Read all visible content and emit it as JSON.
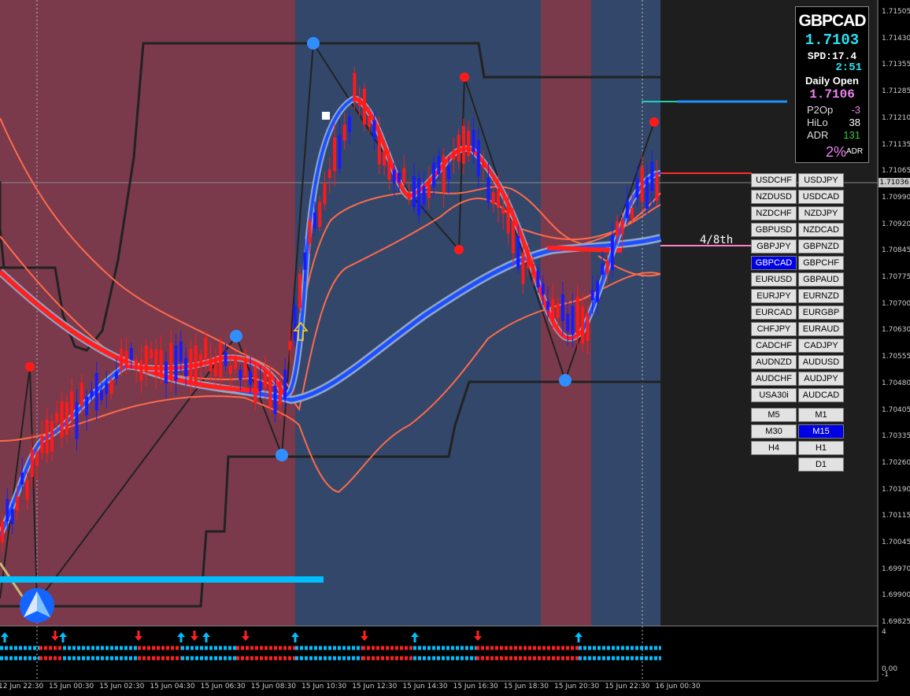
{
  "symbol": "GBPCAD",
  "bid": "1.7103",
  "spread": "SPD:17.4",
  "candle_timer": "2:51",
  "daily_open_label": "Daily Open",
  "daily_open_value": "1.7106",
  "stats": [
    {
      "label": "P2Op",
      "value": "-3",
      "color": "#ee82ee"
    },
    {
      "label": "HiLo",
      "value": "38",
      "color": "#ffffff"
    },
    {
      "label": "ADR",
      "value": "131",
      "color": "#32cd32"
    }
  ],
  "adr_percent": "2%",
  "adr_suffix": "ADR",
  "current_price_tag": "1.71036",
  "level_label": "4/8th",
  "price_axis": [
    "1.71505",
    "1.71430",
    "1.71355",
    "1.71285",
    "1.71210",
    "1.71135",
    "1.71065",
    "1.70990",
    "1.70920",
    "1.70845",
    "1.70775",
    "1.70700",
    "1.70630",
    "1.70555",
    "1.70480",
    "1.70405",
    "1.70335",
    "1.70260",
    "1.70190",
    "1.70115",
    "1.70045",
    "1.69970",
    "1.69900",
    "1.69825"
  ],
  "indicator_axis": [
    "4",
    "0.00",
    "-1"
  ],
  "time_axis": [
    "12 Jun 22:30",
    "15 Jun 00:30",
    "15 Jun 02:30",
    "15 Jun 04:30",
    "15 Jun 06:30",
    "15 Jun 08:30",
    "15 Jun 10:30",
    "15 Jun 12:30",
    "15 Jun 14:30",
    "15 Jun 16:30",
    "15 Jun 18:30",
    "15 Jun 20:30",
    "15 Jun 22:30",
    "16 Jun 00:30"
  ],
  "pair_buttons": [
    [
      "USDCHF",
      "USDJPY"
    ],
    [
      "NZDUSD",
      "USDCAD"
    ],
    [
      "NZDCHF",
      "NZDJPY"
    ],
    [
      "GBPUSD",
      "NZDCAD"
    ],
    [
      "GBPJPY",
      "GBPNZD"
    ],
    [
      "GBPCAD",
      "GBPCHF"
    ],
    [
      "EURUSD",
      "GBPAUD"
    ],
    [
      "EURJPY",
      "EURNZD"
    ],
    [
      "EURCAD",
      "EURGBP"
    ],
    [
      "CHFJPY",
      "EURAUD"
    ],
    [
      "CADCHF",
      "CADJPY"
    ],
    [
      "AUDNZD",
      "AUDUSD"
    ],
    [
      "AUDCHF",
      "AUDJPY"
    ],
    [
      "USA30i",
      "AUDCAD"
    ]
  ],
  "active_pair": "GBPCAD",
  "timeframe_buttons": [
    [
      "M5",
      "M1"
    ],
    [
      "M30",
      "M15"
    ],
    [
      "H4",
      "H1"
    ],
    [
      "",
      "D1"
    ]
  ],
  "active_timeframe": "M15",
  "colors": {
    "session_red": "#7a3a4c",
    "session_blue": "#33476a",
    "bull_candle": "#1a1aff",
    "bear_candle": "#ff1a1a",
    "blue_line": "#1e50ff",
    "red_line": "#ff2020",
    "band": "#ff6a4a",
    "cyan": "#00bfff"
  }
}
